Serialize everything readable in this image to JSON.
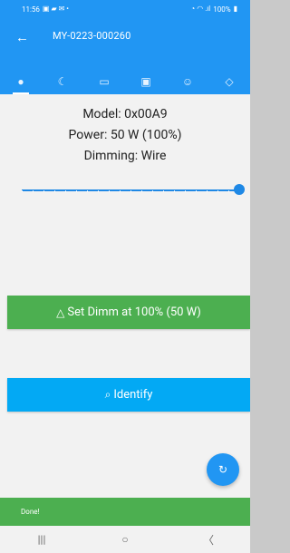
{
  "status_bar": {
    "time": "11:56",
    "left_icons": "▣ ▰ ✉ •",
    "right_icons": "◔ ◠ .ıl",
    "battery_text": "100%",
    "battery_icon": "▮"
  },
  "app_bar": {
    "back_icon": "←",
    "title": "MY-0223-000260"
  },
  "tabs": [
    {
      "icon": "●",
      "name": "bulb-icon"
    },
    {
      "icon": "☾",
      "name": "moon-icon"
    },
    {
      "icon": "▭",
      "name": "message-icon"
    },
    {
      "icon": "▣",
      "name": "chart-icon"
    },
    {
      "icon": "☺",
      "name": "group-icon"
    },
    {
      "icon": "◇",
      "name": "lamp-icon"
    }
  ],
  "device": {
    "model": "Model: 0x00A9",
    "power": "Power: 50 W (100%)",
    "dimming": "Dimming: Wire"
  },
  "slider": {
    "value_percent": 100
  },
  "buttons": {
    "set_icon": "△",
    "set_label": "Set Dimm at 100% (50 W)",
    "identify_icon": "⌕",
    "identify_label": "Identify"
  },
  "fab": {
    "icon": "↻"
  },
  "snackbar": {
    "text": "Done!"
  },
  "navbar": {
    "recent_icon": "|||",
    "home_icon": "○",
    "back_icon": "〈"
  },
  "colors": {
    "primary": "#2196f3",
    "success": "#4caf50",
    "identify": "#03a9f4"
  }
}
